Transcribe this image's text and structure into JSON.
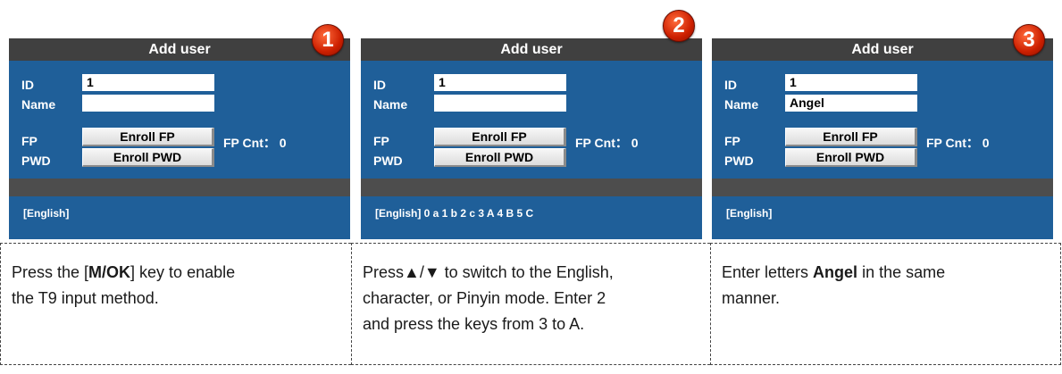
{
  "panels": [
    {
      "title": "Add user",
      "step": "1",
      "labels": {
        "id": "ID",
        "name": "Name",
        "fp": "FP",
        "pwd": "PWD"
      },
      "id_value": "1",
      "name_value": "",
      "enroll_fp_label": "Enroll FP",
      "fp_cnt": "FP Cnt： 0",
      "enroll_pwd_label": "Enroll PWD",
      "status": "[English]"
    },
    {
      "title": "Add user",
      "step": "2",
      "labels": {
        "id": "ID",
        "name": "Name",
        "fp": "FP",
        "pwd": "PWD"
      },
      "id_value": "1",
      "name_value": "",
      "enroll_fp_label": "Enroll FP",
      "fp_cnt": "FP Cnt： 0",
      "enroll_pwd_label": "Enroll PWD",
      "status": "[English] 0 a  1 b  2 c  3 A  4 B  5 C"
    },
    {
      "title": "Add user",
      "step": "3",
      "labels": {
        "id": "ID",
        "name": "Name",
        "fp": "FP",
        "pwd": "PWD"
      },
      "id_value": "1",
      "name_value": "Angel",
      "enroll_fp_label": "Enroll FP",
      "fp_cnt": "FP Cnt： 0",
      "enroll_pwd_label": "Enroll PWD",
      "status": "[English]"
    }
  ],
  "captions": [
    {
      "pre": "Press the [",
      "bold": "M/OK",
      "post": "] key to enable",
      "line2": "the T9 input method."
    },
    {
      "line1": "Press▲/▼ to switch to the English,",
      "line2": "character, or Pinyin mode. Enter 2",
      "line3": "and press the keys from 3 to A."
    },
    {
      "pre": "Enter letters ",
      "bold": "Angel",
      "post": " in the same",
      "line2": "manner."
    }
  ],
  "colors": {
    "screen_bg": "#1f5f99",
    "title_bar": "#404040",
    "badge": "#cc1f00"
  }
}
